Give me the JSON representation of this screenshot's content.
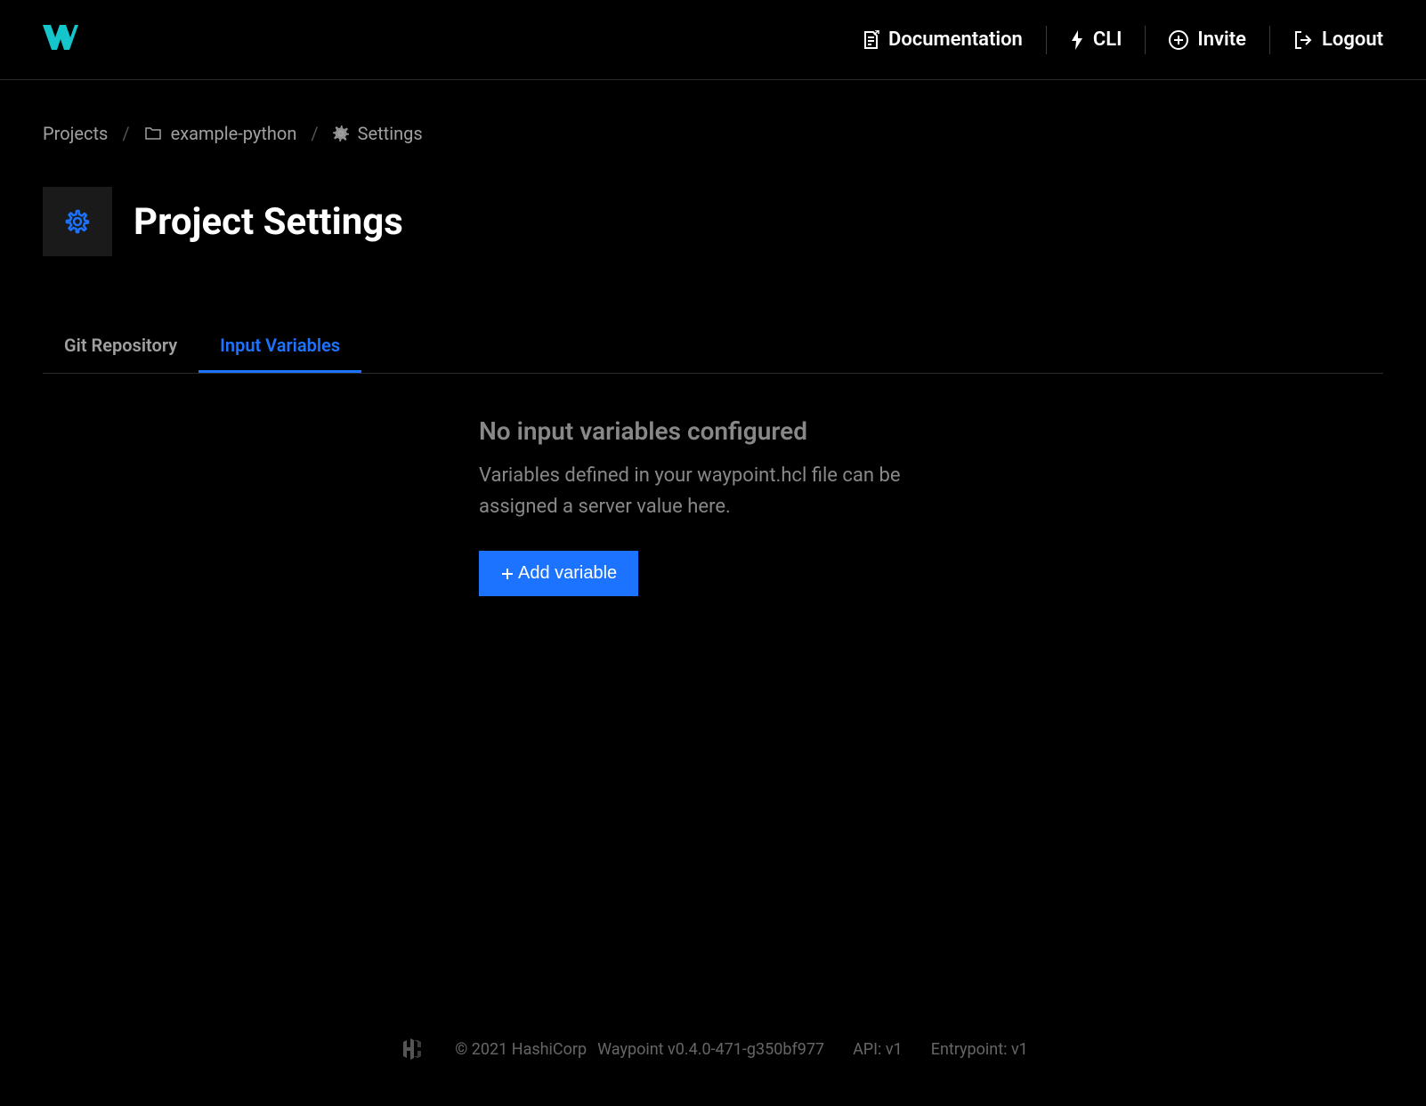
{
  "header": {
    "nav": {
      "documentation": "Documentation",
      "cli": "CLI",
      "invite": "Invite",
      "logout": "Logout"
    }
  },
  "breadcrumb": {
    "projects": "Projects",
    "project_name": "example-python",
    "settings": "Settings"
  },
  "page": {
    "title": "Project Settings"
  },
  "tabs": {
    "git_repository": "Git Repository",
    "input_variables": "Input Variables"
  },
  "empty_state": {
    "title": "No input variables configured",
    "description": "Variables defined in your waypoint.hcl file can be assigned a server value here.",
    "button_label": "Add variable"
  },
  "footer": {
    "copyright": "© 2021 HashiCorp",
    "product": "Waypoint v0.4.0-471-g350bf977",
    "api": "API: v1",
    "entrypoint": "Entrypoint: v1"
  }
}
